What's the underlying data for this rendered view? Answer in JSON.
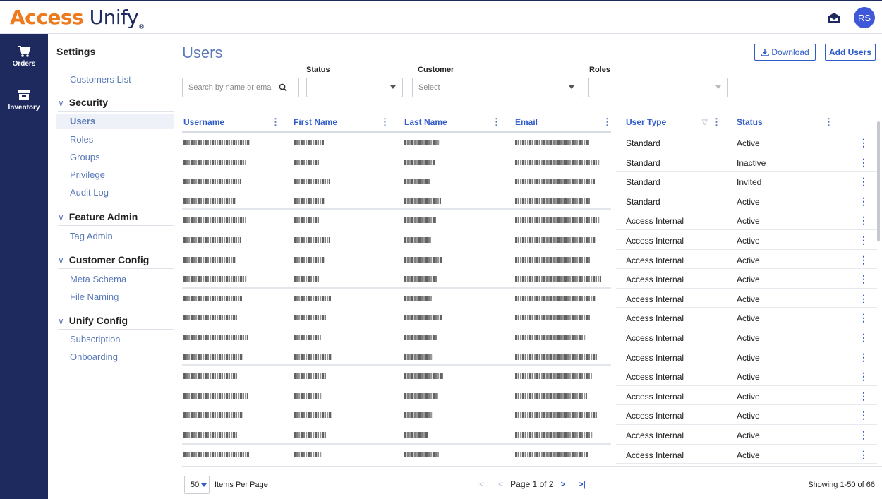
{
  "brand": {
    "part1": "Access",
    "part2": " Unify",
    "reg": "®"
  },
  "header": {
    "avatar_initials": "RS"
  },
  "rail": {
    "items": [
      {
        "label": "Orders",
        "icon": "cart-icon"
      },
      {
        "label": "Inventory",
        "icon": "archive-icon"
      }
    ]
  },
  "settings": {
    "title": "Settings",
    "customers_list": "Customers List",
    "groups": [
      {
        "label": "Security",
        "items": [
          "Users",
          "Roles",
          "Groups",
          "Privilege",
          "Audit Log"
        ]
      },
      {
        "label": "Feature Admin",
        "items": [
          "Tag Admin"
        ]
      },
      {
        "label": "Customer Config",
        "items": [
          "Meta Schema",
          "File Naming"
        ]
      },
      {
        "label": "Unify Config",
        "items": [
          "Subscription",
          "Onboarding"
        ]
      }
    ],
    "active_item": "Users"
  },
  "page": {
    "title": "Users",
    "download_label": "Download",
    "add_users_label": "Add Users"
  },
  "filters": {
    "search_placeholder": "Search by name or ema",
    "status_label": "Status",
    "status_value": "",
    "customer_label": "Customer",
    "customer_placeholder": "Select",
    "roles_label": "Roles",
    "roles_value": ""
  },
  "table": {
    "columns": [
      "Username",
      "First Name",
      "Last Name",
      "Email",
      "User Type",
      "Status"
    ],
    "rows": [
      {
        "user_type": "Standard",
        "status": "Active"
      },
      {
        "user_type": "Standard",
        "status": "Inactive"
      },
      {
        "user_type": "Standard",
        "status": "Invited"
      },
      {
        "user_type": "Standard",
        "status": "Active"
      },
      {
        "user_type": "Access Internal",
        "status": "Active"
      },
      {
        "user_type": "Access Internal",
        "status": "Active"
      },
      {
        "user_type": "Access Internal",
        "status": "Active"
      },
      {
        "user_type": "Access Internal",
        "status": "Active"
      },
      {
        "user_type": "Access Internal",
        "status": "Active"
      },
      {
        "user_type": "Access Internal",
        "status": "Active"
      },
      {
        "user_type": "Access Internal",
        "status": "Active"
      },
      {
        "user_type": "Access Internal",
        "status": "Active"
      },
      {
        "user_type": "Access Internal",
        "status": "Active"
      },
      {
        "user_type": "Access Internal",
        "status": "Active"
      },
      {
        "user_type": "Access Internal",
        "status": "Active"
      },
      {
        "user_type": "Access Internal",
        "status": "Active"
      },
      {
        "user_type": "Access Internal",
        "status": "Active"
      }
    ]
  },
  "footer": {
    "page_size": "50",
    "items_per_page": "Items Per Page",
    "page_label": "Page 1 of 2",
    "showing": "Showing 1-50 of 66"
  },
  "colors": {
    "navy": "#1e2a5e",
    "orange": "#ee7a1e",
    "link": "#5a7ab8",
    "primary": "#2f5cc9"
  }
}
